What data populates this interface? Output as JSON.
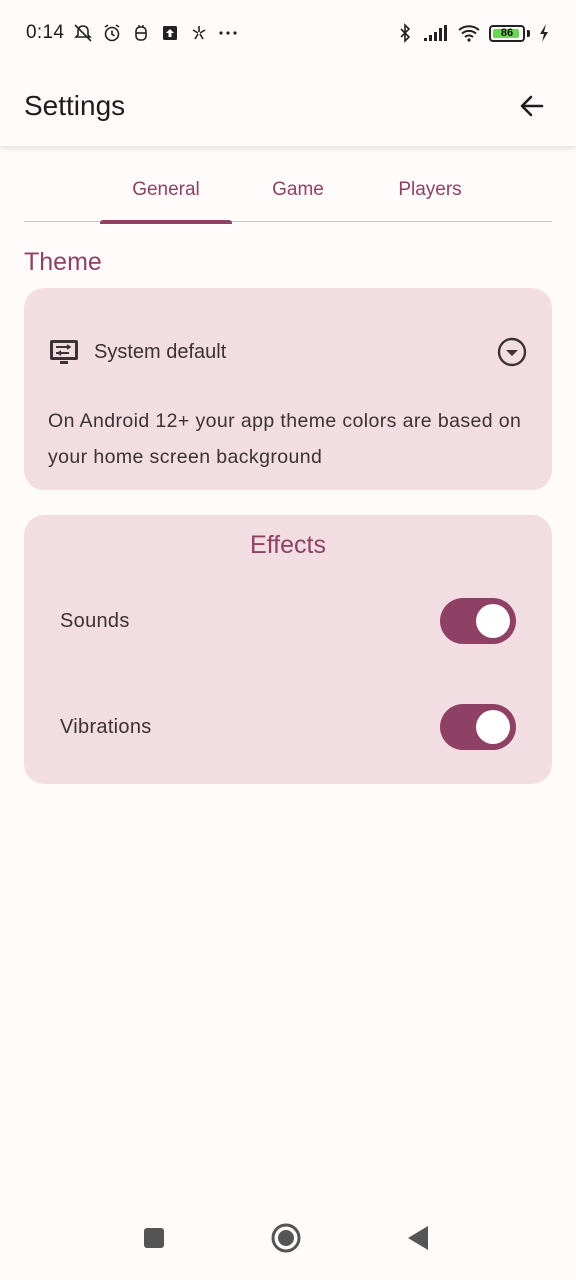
{
  "status_bar": {
    "time": "0:14",
    "battery_level": "86",
    "icons": [
      "muted-notifications-icon",
      "alarm-icon",
      "app-notification-icon",
      "upload-icon",
      "sync-icon",
      "more-icon",
      "bluetooth-icon",
      "signal-icon",
      "wifi-icon",
      "battery-icon",
      "charging-icon"
    ]
  },
  "app_bar": {
    "title": "Settings",
    "back_icon": "arrow-back-icon"
  },
  "tabs": [
    {
      "label": "General",
      "active": true
    },
    {
      "label": "Game",
      "active": false
    },
    {
      "label": "Players",
      "active": false
    }
  ],
  "theme": {
    "section_title": "Theme",
    "selected_value": "System default",
    "note": "On Android 12+ your app theme colors are based on your home screen background"
  },
  "effects": {
    "title": "Effects",
    "items": [
      {
        "label": "Sounds",
        "enabled": true
      },
      {
        "label": "Vibrations",
        "enabled": true
      }
    ]
  },
  "colors": {
    "accent": "#8e4164",
    "card_background": "#f2dde2",
    "page_background": "#fffbfa"
  },
  "nav_bar": {
    "icons": [
      "recents-icon",
      "home-icon",
      "back-triangle-icon"
    ]
  }
}
